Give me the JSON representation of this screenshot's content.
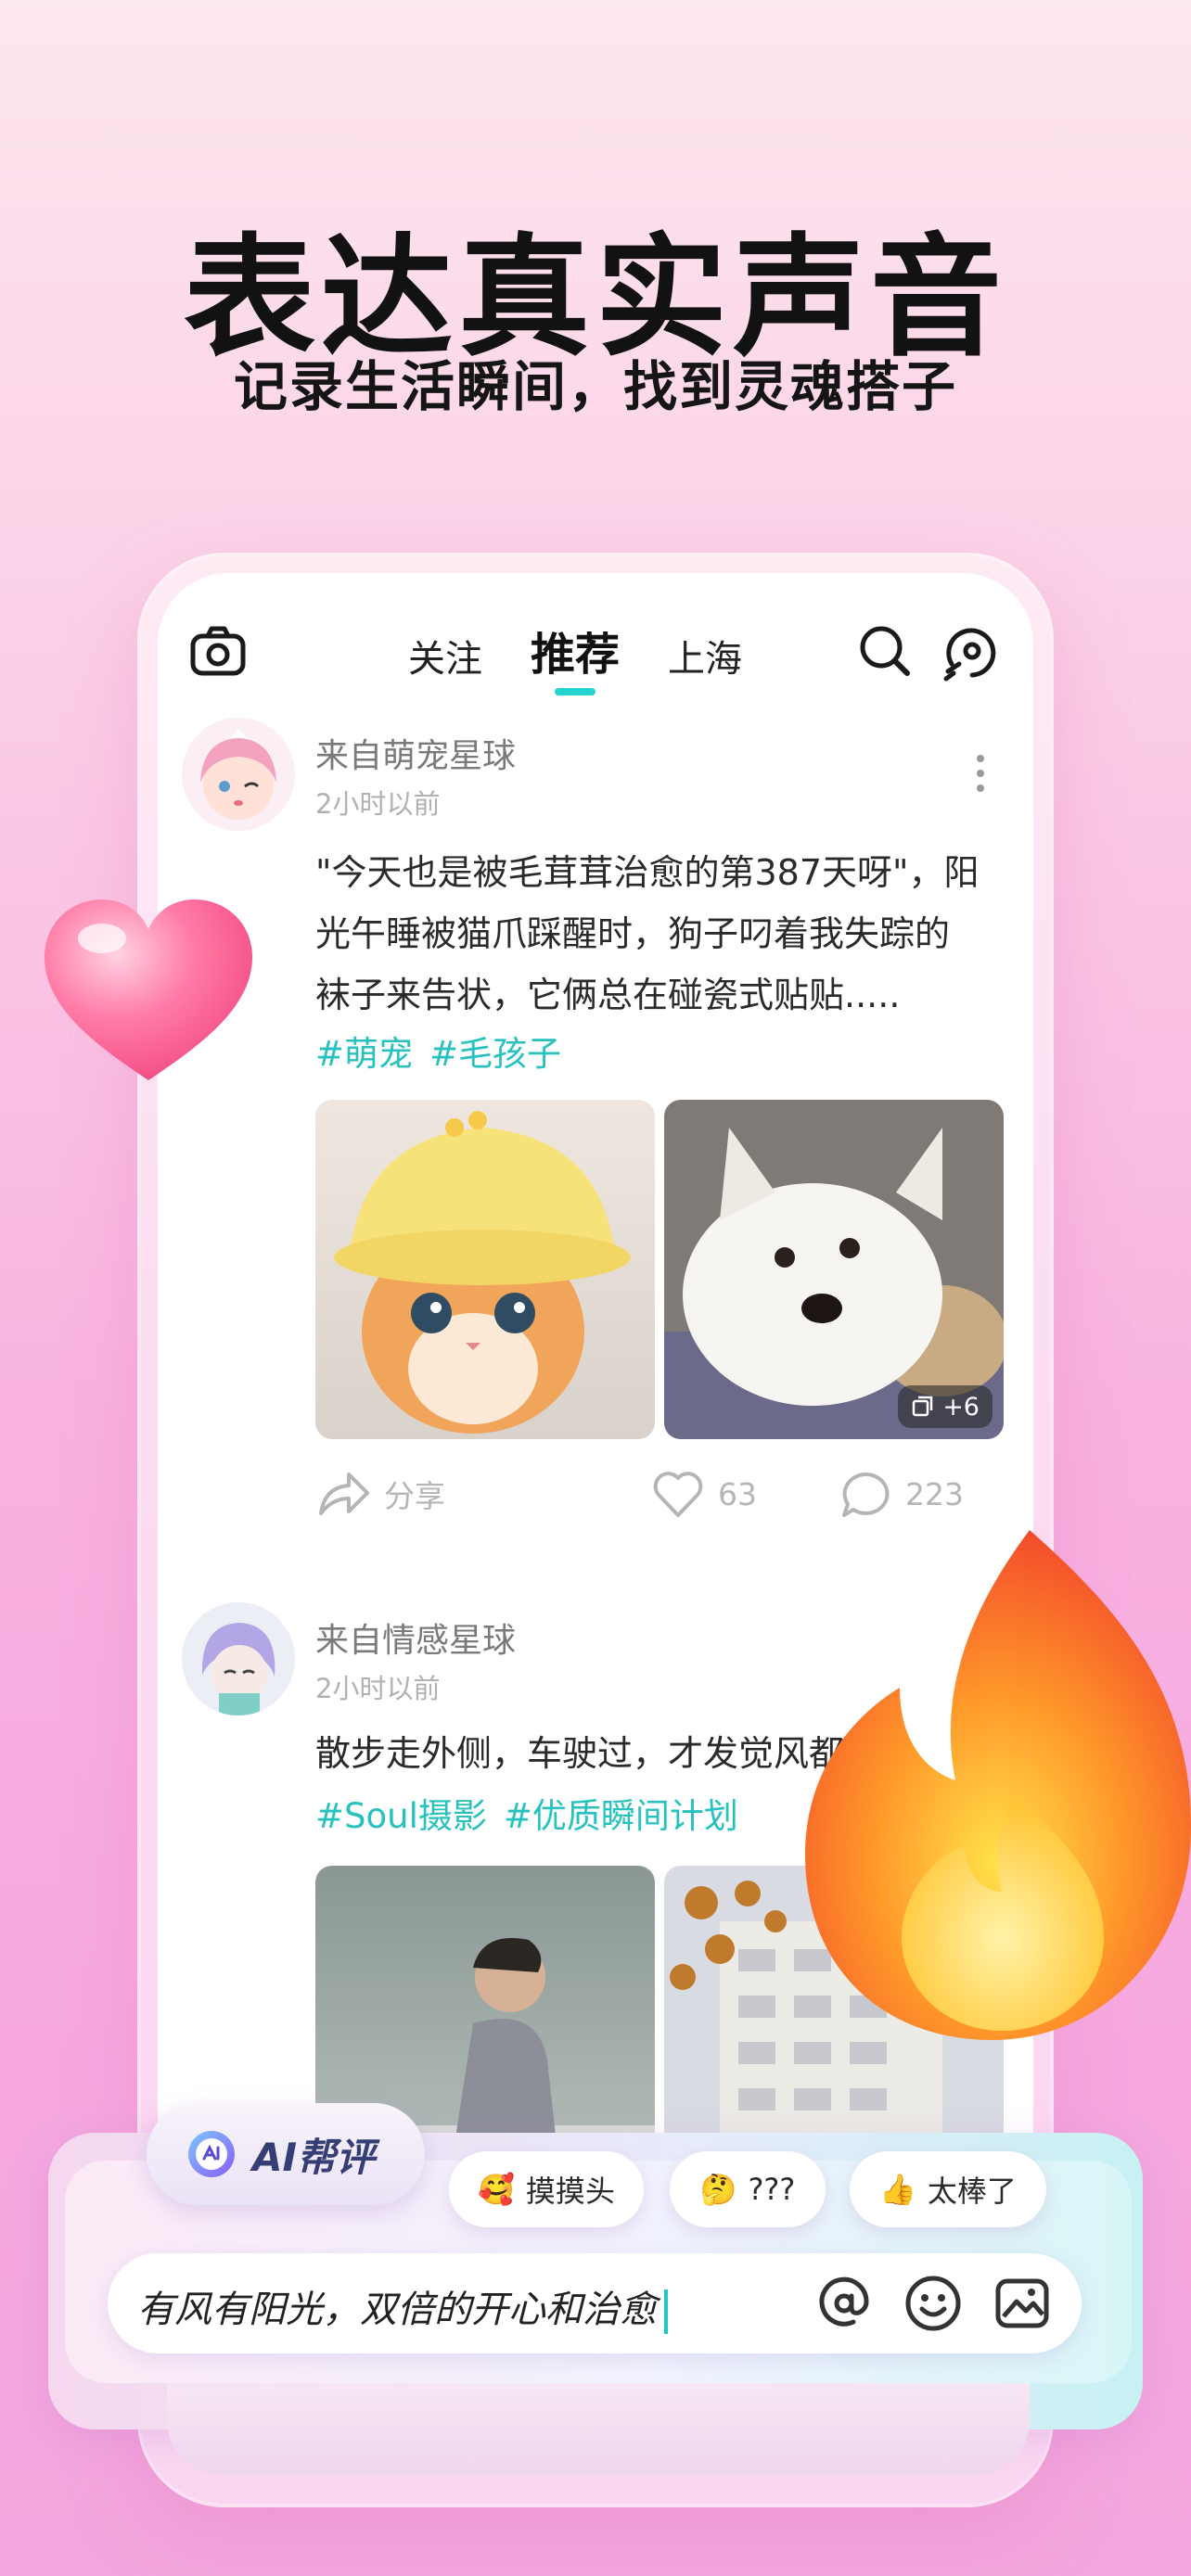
{
  "hero": {
    "title": "表达真实声音",
    "subtitle": "记录生活瞬间，找到灵魂搭子"
  },
  "header": {
    "tabs": [
      {
        "label": "关注",
        "active": false
      },
      {
        "label": "推荐",
        "active": true
      },
      {
        "label": "上海",
        "active": false
      }
    ],
    "icons": [
      "camera-icon",
      "search-icon",
      "voice-match-icon"
    ]
  },
  "posts": [
    {
      "source": "来自萌宠星球",
      "time": "2小时以前",
      "text": "\"今天也是被毛茸茸治愈的第387天呀\"，阳光午睡被猫爪踩醒时，狗子叼着我失踪的袜子来告状，它俩总在碰瓷式贴贴.....",
      "tags": [
        "#萌宠",
        "#毛孩子"
      ],
      "photo_extra_count": "+6",
      "share_label": "分享",
      "likes": "63",
      "comments": "223"
    },
    {
      "source": "来自情感星球",
      "time": "2小时以前",
      "text": "散步走外侧，车驶过，才发觉风都",
      "tags": [
        "#Soul摄影",
        "#优质瞬间计划"
      ]
    }
  ],
  "comment_panel": {
    "ai_label": "AI帮评",
    "chips": [
      {
        "emoji": "🥰",
        "label": "摸摸头"
      },
      {
        "emoji": "🤔",
        "label": "???"
      },
      {
        "emoji": "👍",
        "label": "太棒了"
      }
    ],
    "input_text": "有风有阳光，双倍的开心和治愈"
  },
  "colors": {
    "accent": "#25d4d0",
    "tag": "#28c2be",
    "background_top": "#fde7ef",
    "background_bottom": "#f3a6dd"
  }
}
